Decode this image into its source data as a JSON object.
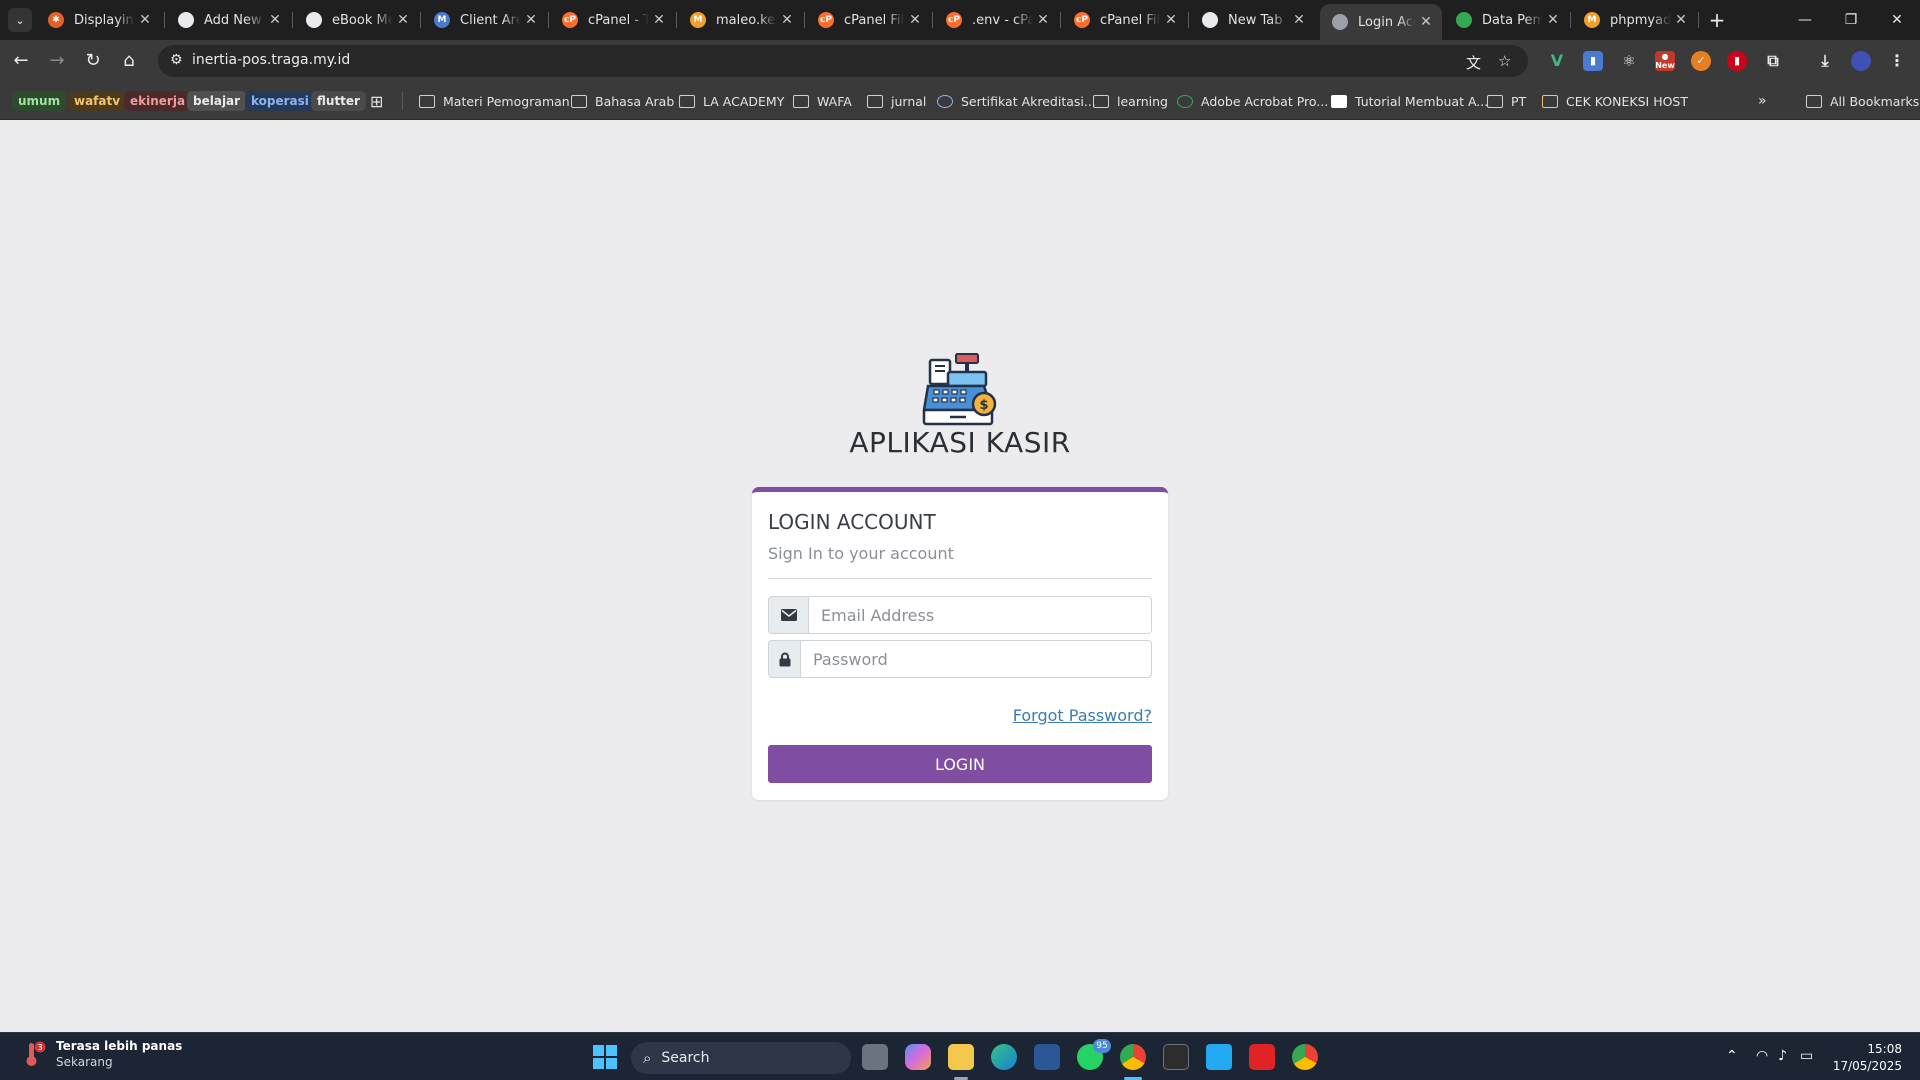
{
  "tabs": [
    {
      "title": "Displaying",
      "favicon": "#e0622b",
      "active": false
    },
    {
      "title": "Add New S",
      "favicon": "#e8eaed",
      "active": false
    },
    {
      "title": "eBook Me",
      "favicon": "#e8eaed",
      "active": false
    },
    {
      "title": "Client Area",
      "favicon": "#4a7bd0",
      "active": false
    },
    {
      "title": "cPanel - To",
      "favicon": "#ff6c2c",
      "active": false
    },
    {
      "title": "maleo.kem",
      "favicon": "#f2a02c",
      "active": false
    },
    {
      "title": "cPanel File",
      "favicon": "#ff6c2c",
      "active": false
    },
    {
      "title": ".env - cPan",
      "favicon": "#ff6c2c",
      "active": false
    },
    {
      "title": "cPanel File",
      "favicon": "#ff6c2c",
      "active": false
    },
    {
      "title": "New Tab",
      "favicon": "#e8eaed",
      "active": false
    },
    {
      "title": "Login Acco",
      "favicon": "#9aa0a6",
      "active": true
    },
    {
      "title": "Data Pema",
      "favicon": "#34a853",
      "active": false
    },
    {
      "title": "phpmyadm",
      "favicon": "#f2a02c",
      "active": false
    }
  ],
  "address_bar": {
    "url": "inertia-pos.traga.my.id"
  },
  "extension_badge": "New",
  "bookmark_chips": [
    {
      "label": "umum",
      "bg": "#2f4a2f",
      "fg": "#9ee39e"
    },
    {
      "label": "wafatv",
      "bg": "#4a3b20",
      "fg": "#f2c46b"
    },
    {
      "label": "ekinerja",
      "bg": "#4a2a2a",
      "fg": "#f19a9a"
    },
    {
      "label": "belajar",
      "bg": "#505050",
      "fg": "#e8eaed"
    },
    {
      "label": "koperasi",
      "bg": "#273a55",
      "fg": "#8ab4f8"
    },
    {
      "label": "flutter",
      "bg": "#4a4a4a",
      "fg": "#e8eaed"
    }
  ],
  "bookmarks": [
    {
      "label": "Materi Pemograman",
      "icon": "folder-icon"
    },
    {
      "label": "Bahasa Arab",
      "icon": "folder-icon"
    },
    {
      "label": "LA ACADEMY",
      "icon": "folder-icon"
    },
    {
      "label": "WAFA",
      "icon": "folder-icon"
    },
    {
      "label": "jurnal",
      "icon": "folder-icon"
    },
    {
      "label": "Sertifikat Akreditasi...",
      "icon": "globe-icon"
    },
    {
      "label": "learning",
      "icon": "folder-icon"
    },
    {
      "label": "Adobe Acrobat Pro...",
      "icon": "document-icon"
    },
    {
      "label": "Tutorial Membuat A...",
      "icon": "document-icon"
    },
    {
      "label": "PT",
      "icon": "folder-icon"
    },
    {
      "label": "CEK KONEKSI HOST",
      "icon": "folder-icon"
    }
  ],
  "all_bookmarks_label": "All Bookmarks",
  "login": {
    "app_title": "APLIKASI KASIR",
    "card_title": "LOGIN ACCOUNT",
    "card_subtitle": "Sign In to your account",
    "email_placeholder": "Email Address",
    "password_placeholder": "Password",
    "forgot_label": "Forgot Password?",
    "login_button": "LOGIN",
    "accent": "#7f4ea3"
  },
  "taskbar": {
    "weather_title": "Terasa lebih panas",
    "weather_sub": "Sekarang",
    "weather_badge": "3",
    "search_label": "Search",
    "whatsapp_badge": "95",
    "time": "15:08",
    "date": "17/05/2025"
  }
}
